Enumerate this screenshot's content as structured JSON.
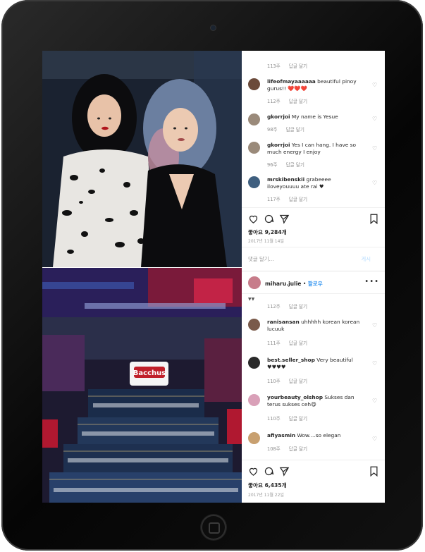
{
  "post1": {
    "top_meta": {
      "time": "113주",
      "reply": "답글 달기"
    },
    "comments": [
      {
        "user": "lifeofmayaaaaaa",
        "text": "beautiful pinoy gurus!! ❤️❤️❤️",
        "time": "112주",
        "reply": "답글 달기",
        "avatar_color": "#6b4a3a"
      },
      {
        "user": "gkorrjoi",
        "text": "My name is Yesue",
        "time": "98주",
        "reply": "답글 달기",
        "avatar_color": "#9a8a7a"
      },
      {
        "user": "gkorrjoi",
        "text": "Yes I can hang. I have so much energy I enjoy",
        "time": "96주",
        "reply": "답글 달기",
        "avatar_color": "#9a8a7a"
      },
      {
        "user": "mrskibenskii",
        "text": "grabeeee iloveyouuuu ate rai ♥",
        "time": "117주",
        "reply": "답글 달기",
        "avatar_color": "#3f5f7f"
      }
    ],
    "likes": "좋아요 9,284개",
    "date": "2017년 11월 14일",
    "add_comment_placeholder": "댓글 달기...",
    "post_label": "게시"
  },
  "post2": {
    "header": {
      "user": "miharu.julie",
      "dot": " • ",
      "follow": "팔로우",
      "avatar_color": "#c77c8a"
    },
    "top_meta": {
      "time": "112주",
      "reply": "답글 달기"
    },
    "comments": [
      {
        "user": "ranisansan",
        "text": "uhhhhh korean korean lucuuk",
        "time": "111주",
        "reply": "답글 달기",
        "avatar_color": "#7a5a4a"
      },
      {
        "user": "best.seller_shop",
        "text": "Very beautiful ♥♥♥♥",
        "time": "110주",
        "reply": "답글 달기",
        "avatar_color": "#2a2a2a"
      },
      {
        "user": "yourbeauty_olshop",
        "text": "Sukses dan terus sukses ceh😋",
        "time": "110주",
        "reply": "답글 달기",
        "avatar_color": "#d9a0b8"
      },
      {
        "user": "afiyasmin",
        "text": "Wow....so elegan",
        "time": "108주",
        "reply": "답글 달기",
        "avatar_color": "#c8a070"
      }
    ],
    "likes": "좋아요 6,435개",
    "date": "2017년 11월 22일"
  },
  "icons": [
    "heart-icon",
    "comment-icon",
    "share-icon",
    "bookmark-icon",
    "more-icon",
    "home-button"
  ],
  "colors": {
    "link_blue": "#3897f0",
    "text": "#262626",
    "muted": "#8e8e8e",
    "bezel": "#0a0a0a"
  }
}
